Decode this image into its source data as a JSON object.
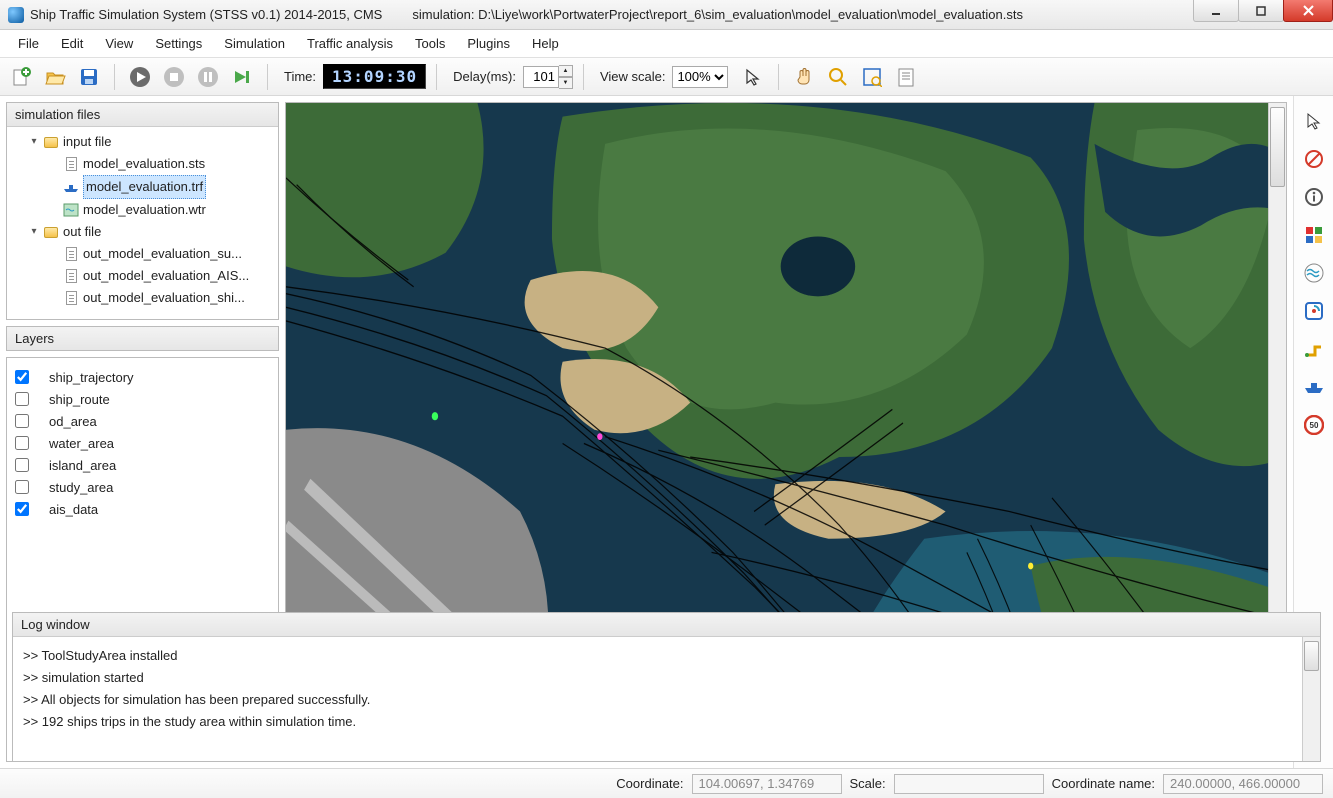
{
  "titlebar": {
    "app_title": "Ship Traffic Simulation System (STSS v0.1) 2014-2015, CMS",
    "sim_label": "simulation: D:\\Liye\\work\\PortwaterProject\\report_6\\sim_evaluation\\model_evaluation\\model_evaluation.sts"
  },
  "menu": [
    "File",
    "Edit",
    "View",
    "Settings",
    "Simulation",
    "Traffic analysis",
    "Tools",
    "Plugins",
    "Help"
  ],
  "toolbar": {
    "time_label": "Time:",
    "time_value": "13:09:30",
    "delay_label": "Delay(ms):",
    "delay_value": "101",
    "scale_label": "View scale:",
    "scale_value": "100%"
  },
  "simfiles": {
    "header": "simulation files",
    "tree": [
      {
        "level": 1,
        "twisty": "▾",
        "icon": "folder",
        "label": "input file"
      },
      {
        "level": 2,
        "twisty": "",
        "icon": "file",
        "label": "model_evaluation.sts"
      },
      {
        "level": 2,
        "twisty": "",
        "icon": "trf",
        "label": "model_evaluation.trf",
        "selected": true
      },
      {
        "level": 2,
        "twisty": "",
        "icon": "wtr",
        "label": "model_evaluation.wtr"
      },
      {
        "level": 1,
        "twisty": "▾",
        "icon": "folder",
        "label": "out file"
      },
      {
        "level": 2,
        "twisty": "",
        "icon": "file",
        "label": "out_model_evaluation_su..."
      },
      {
        "level": 2,
        "twisty": "",
        "icon": "file",
        "label": "out_model_evaluation_AIS..."
      },
      {
        "level": 2,
        "twisty": "",
        "icon": "file",
        "label": "out_model_evaluation_shi..."
      }
    ]
  },
  "layers": {
    "header": "Layers",
    "items": [
      {
        "checked": true,
        "label": "ship_trajectory"
      },
      {
        "checked": false,
        "label": "ship_route"
      },
      {
        "checked": false,
        "label": "od_area"
      },
      {
        "checked": false,
        "label": "water_area"
      },
      {
        "checked": false,
        "label": "island_area"
      },
      {
        "checked": false,
        "label": "study_area"
      },
      {
        "checked": true,
        "label": "ais_data"
      }
    ]
  },
  "log": {
    "header": "Log window",
    "lines": [
      ">> ToolStudyArea installed",
      ">> simulation started",
      ">> All objects for simulation has been prepared successfully.",
      ">> 192 ships trips in the study area within simulation time."
    ]
  },
  "status": {
    "coord_label": "Coordinate:",
    "coord_value": "104.00697, 1.34769",
    "scale_label": "Scale:",
    "scale_value": "",
    "coordname_label": "Coordinate name:",
    "coordname_value": "240.00000, 466.00000"
  }
}
